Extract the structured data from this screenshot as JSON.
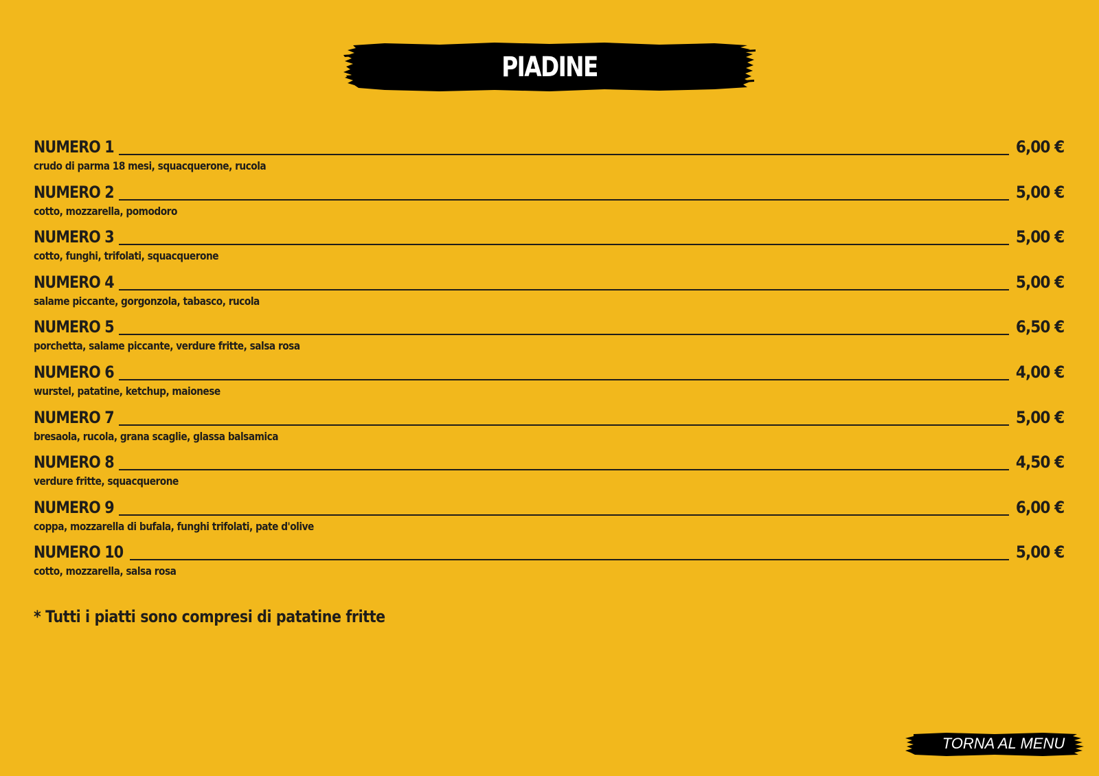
{
  "header": {
    "title": "PIADINE"
  },
  "menu": {
    "items": [
      {
        "name": "NUMERO 1",
        "price": "6,00 €",
        "description": "crudo di parma 18 mesi, squacquerone, rucola"
      },
      {
        "name": "NUMERO 2",
        "price": "5,00 €",
        "description": "cotto, mozzarella, pomodoro"
      },
      {
        "name": "NUMERO 3",
        "price": "5,00 €",
        "description": "cotto, funghi, trifolati, squacquerone"
      },
      {
        "name": "NUMERO 4",
        "price": "5,00 €",
        "description": "salame piccante, gorgonzola, tabasco, rucola"
      },
      {
        "name": "NUMERO 5",
        "price": "6,50 €",
        "description": "porchetta, salame piccante, verdure fritte, salsa rosa"
      },
      {
        "name": "NUMERO 6",
        "price": "4,00 €",
        "description": "wurstel, patatine, ketchup, maionese"
      },
      {
        "name": "NUMERO 7",
        "price": "5,00 €",
        "description": "bresaola, rucola, grana scaglie, glassa balsamica"
      },
      {
        "name": "NUMERO 8",
        "price": "4,50 €",
        "description": "verdure fritte, squacquerone"
      },
      {
        "name": "NUMERO 9",
        "price": "6,00 €",
        "description": "coppa, mozzarella di bufala, funghi trifolati, pate d'olive"
      },
      {
        "name": "NUMERO 10",
        "price": "5,00 €",
        "description": "cotto, mozzarella, salsa rosa"
      }
    ]
  },
  "footnote": "* Tutti i piatti sono compresi di patatine fritte",
  "navigation": {
    "back_label": "TORNA AL MENU"
  },
  "colors": {
    "background": "#F2B81C",
    "text": "#1f1d1a",
    "banner": "#000000",
    "banner_text": "#ffffff"
  }
}
